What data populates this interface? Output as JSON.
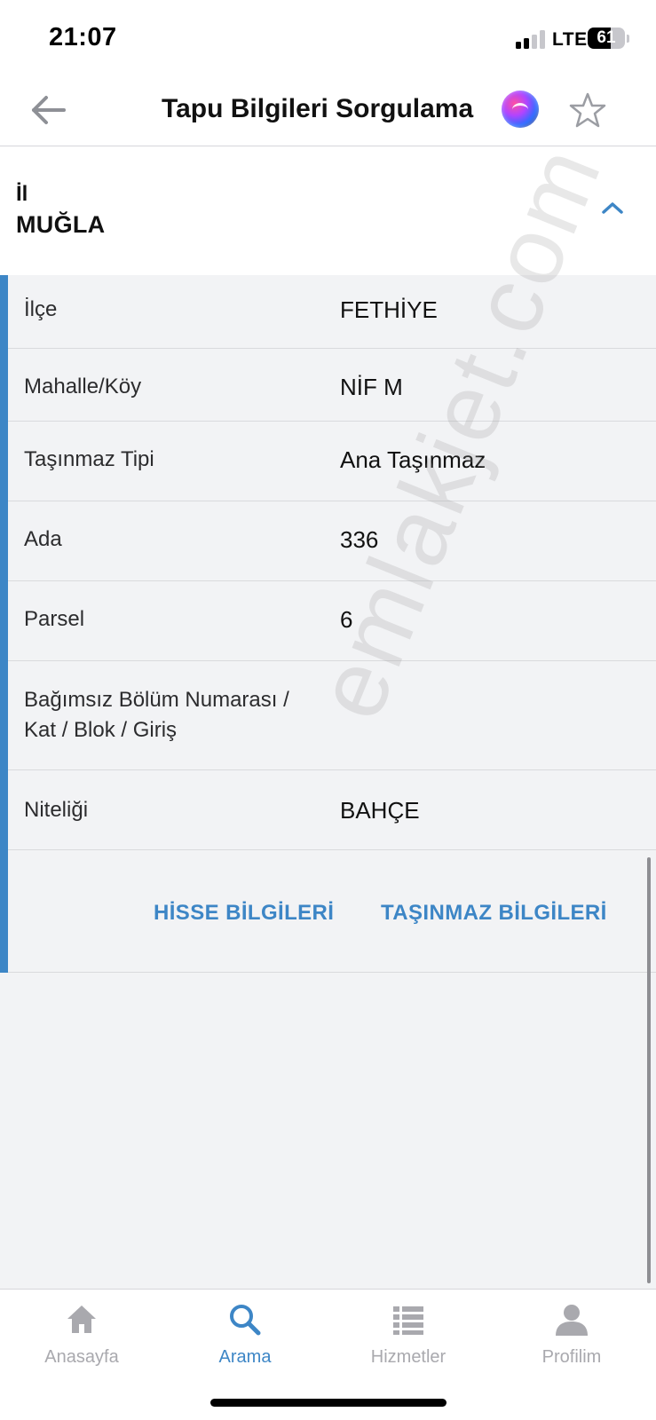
{
  "status_bar": {
    "time": "21:07",
    "network": "LTE",
    "battery_percent": "61",
    "battery_level": 0.61,
    "signal_bars_active": 2,
    "signal_bars_total": 4
  },
  "header": {
    "title": "Tapu Bilgileri Sorgulama",
    "back_icon": "arrow-left-icon",
    "assistant_icon": "siri-icon",
    "favorite_icon": "star-outline-icon"
  },
  "province": {
    "label": "İl",
    "value": "MUĞLA",
    "toggle_icon": "chevron-up-icon"
  },
  "details": [
    {
      "label": "İlçe",
      "value": "FETHİYE"
    },
    {
      "label": "Mahalle/Köy",
      "value": "NİF M"
    },
    {
      "label": "Taşınmaz Tipi",
      "value": "Ana Taşınmaz"
    },
    {
      "label": "Ada",
      "value": "336"
    },
    {
      "label": "Parsel",
      "value": "6"
    },
    {
      "label_line1": "Bağımsız Bölüm Numarası /",
      "label_line2": "Kat / Blok / Giriş",
      "value": ""
    },
    {
      "label": "Niteliği",
      "value": "BAHÇE"
    }
  ],
  "actions": {
    "share_info": "HİSSE BİLGİLERİ",
    "property_info": "TAŞINMAZ BİLGİLERİ"
  },
  "watermark": "emlakjet.com",
  "tabbar": {
    "items": [
      {
        "label": "Anasayfa",
        "icon": "home-icon",
        "active": false
      },
      {
        "label": "Arama",
        "icon": "search-icon",
        "active": true
      },
      {
        "label": "Hizmetler",
        "icon": "list-icon",
        "active": false
      },
      {
        "label": "Profilim",
        "icon": "person-icon",
        "active": false
      }
    ]
  },
  "colors": {
    "accent": "#3d86c6",
    "content_background": "#f2f3f5",
    "inactive_tab": "#a9a9ae"
  }
}
